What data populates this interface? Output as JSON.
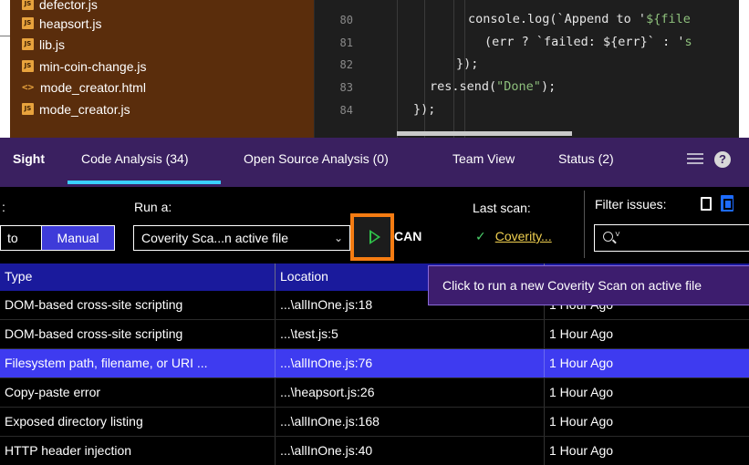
{
  "file_tree": {
    "items": [
      {
        "name": "defector.js",
        "kind": "js"
      },
      {
        "name": "heapsort.js",
        "kind": "js"
      },
      {
        "name": "lib.js",
        "kind": "js"
      },
      {
        "name": "min-coin-change.js",
        "kind": "js"
      },
      {
        "name": "mode_creator.html",
        "kind": "html"
      },
      {
        "name": "mode_creator.js",
        "kind": "js"
      }
    ]
  },
  "editor": {
    "line_numbers": [
      "80",
      "81",
      "82",
      "83",
      "84"
    ],
    "lines": {
      "l80_a": "console.log(`Append to '",
      "l80_b": "${file",
      "l81_a": "(err ? `failed: ${err}` : '",
      "l81_b": "s",
      "l82": "});",
      "l83_a": "res.send(",
      "l83_str": "\"Done\"",
      "l83_b": ");",
      "l84": "});"
    }
  },
  "tabs": {
    "sight": "Sight",
    "code_analysis": "Code Analysis (34)",
    "open_source": "Open Source Analysis (0)",
    "team_view": "Team View",
    "status": "Status (2)"
  },
  "toolbar": {
    "mode_label": ":",
    "mode_auto": "to",
    "mode_manual": "Manual",
    "run_label": "Run a:",
    "run_value": "Coverity Sca...n active file",
    "scan_label": "CAN",
    "last_scan_label": "Last scan:",
    "last_scan_value": "Coverity...",
    "filter_label": "Filter issues:"
  },
  "table": {
    "headers": {
      "type": "Type",
      "location": "Location"
    },
    "rows": [
      {
        "type": "DOM-based cross-site scripting",
        "location": "...\\allInOne.js:18",
        "time": "1 Hour Ago"
      },
      {
        "type": "DOM-based cross-site scripting",
        "location": "...\\test.js:5",
        "time": "1 Hour Ago"
      },
      {
        "type": "Filesystem path, filename, or URI ...",
        "location": "...\\allInOne.js:76",
        "time": "1 Hour Ago"
      },
      {
        "type": "Copy-paste error",
        "location": "...\\heapsort.js:26",
        "time": "1 Hour Ago"
      },
      {
        "type": "Exposed directory listing",
        "location": "...\\allInOne.js:168",
        "time": "1 Hour Ago"
      },
      {
        "type": "HTTP header injection",
        "location": "...\\allInOne.js:40",
        "time": "1 Hour Ago"
      }
    ],
    "selected_index": 2
  },
  "tooltip": {
    "text": "Click to run a new Coverity Scan on active file"
  },
  "colors": {
    "file_tree_bg": "#5a2d0c",
    "tab_bar_bg": "#3a2060",
    "accent_underline": "#3ad0ff",
    "highlight_frame": "#f57c12",
    "selected_row": "#3e3bf0",
    "play_green": "#2fc24a"
  }
}
